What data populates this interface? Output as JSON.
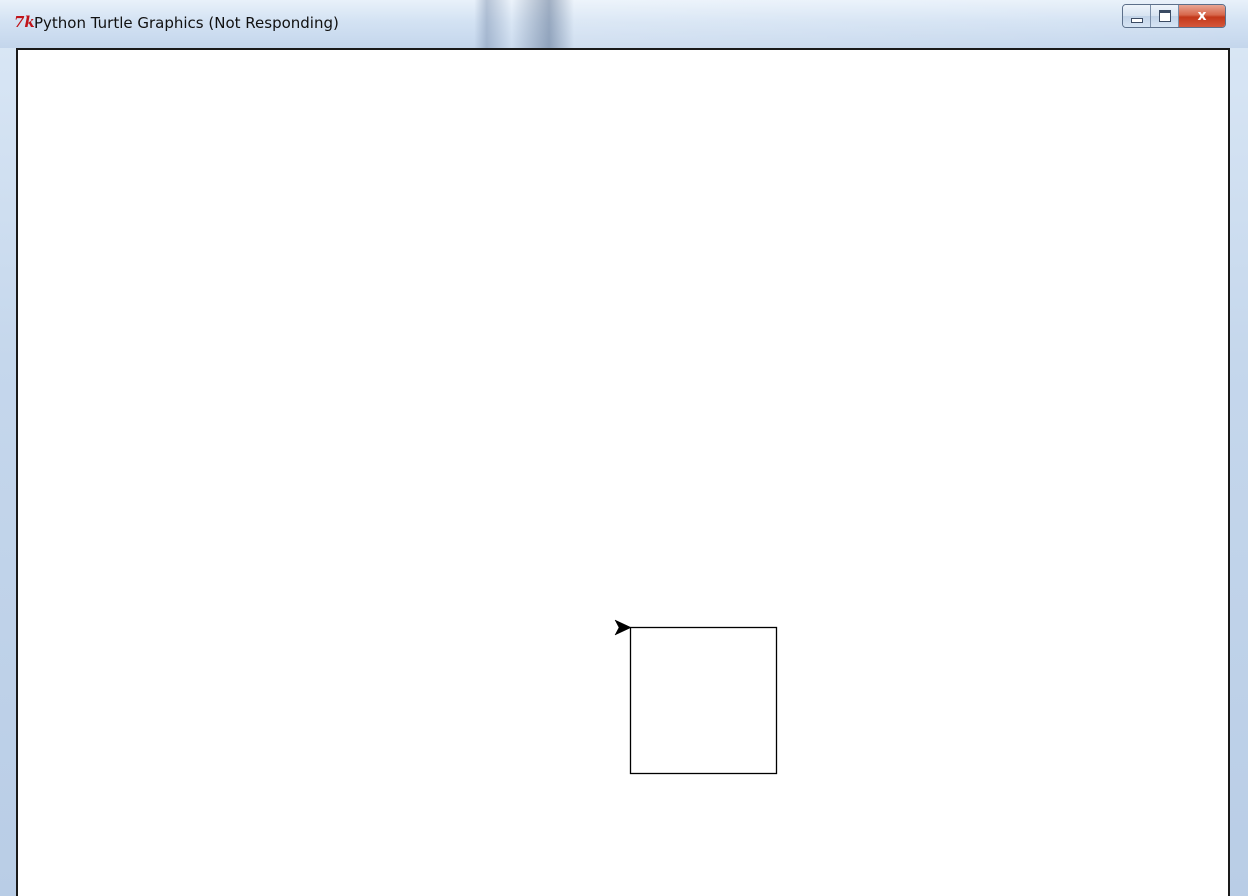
{
  "window": {
    "title": "Python Turtle Graphics (Not Responding)",
    "app_icon": "tk-icon",
    "app_icon_text": "7k",
    "controls": {
      "minimize_icon": "minimize-icon",
      "maximize_icon": "maximize-icon",
      "close_icon": "close-icon",
      "close_glyph": "x"
    }
  },
  "canvas": {
    "background": "#ffffff",
    "drawing": {
      "shape": "square",
      "stroke": "#000000",
      "turtle_cursor": "arrow-cursor-icon",
      "turtle_heading": "right"
    }
  }
}
